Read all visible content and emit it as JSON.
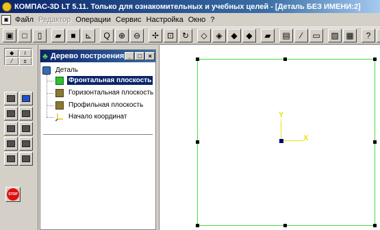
{
  "window": {
    "title": "КОМПАС-3D LT 5.11. Только для ознакомительных и учебных целей - [Деталь БЕЗ ИМЕНИ:2]"
  },
  "menu": {
    "items": [
      {
        "label": "Файл",
        "enabled": true
      },
      {
        "label": "Редактор",
        "enabled": false
      },
      {
        "label": "Операции",
        "enabled": true
      },
      {
        "label": "Сервис",
        "enabled": true
      },
      {
        "label": "Настройка",
        "enabled": true
      },
      {
        "label": "Окно",
        "enabled": true
      },
      {
        "label": "?",
        "enabled": true
      }
    ]
  },
  "toolbar": {
    "icons": [
      "document-props-icon",
      "new-document-icon",
      "new-sheet-icon",
      "open-folder-icon",
      "save-icon",
      "show-all-icon",
      "zoom-window-icon",
      "zoom-in-icon",
      "zoom-out-icon",
      "pan-icon",
      "zoom-fit-icon",
      "rotate-icon",
      "view-wireframe-icon",
      "view-hidden-lines-icon",
      "view-hidden-thin-icon",
      "view-shaded-icon",
      "view-perspective-icon",
      "properties-icon",
      "measure-icon",
      "settings-icon",
      "print-preview-icon",
      "print-icon",
      "help-icon",
      "info-icon"
    ]
  },
  "tree_panel": {
    "title": "Дерево построения",
    "root": "Деталь",
    "items": [
      {
        "label": "Фронтальная плоскость",
        "selected": true
      },
      {
        "label": "Горизонтальная плоскость",
        "selected": false
      },
      {
        "label": "Профильная плоскость",
        "selected": false
      },
      {
        "label": "Начало координат",
        "selected": false
      }
    ]
  },
  "canvas": {
    "axis_y_label": "Y",
    "axis_x_label": "X",
    "frame_color": "#40e040",
    "axis_color": "#f0e000"
  },
  "left_panel": {
    "stop_label": "STOP"
  }
}
